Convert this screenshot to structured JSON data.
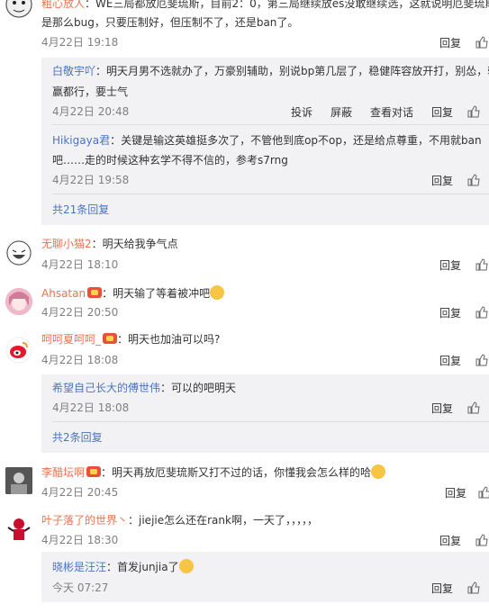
{
  "comments": [
    {
      "user": "粗心放人",
      "text_line1": "：WE三局都放厄斐琉斯，目前2：0，第三局继续放es没敢继续选，这就说明厄斐琉斯",
      "text_line2": "是那么bug，只要压制好，但压制不了，还是ban了。",
      "time": "4月22日 19:18",
      "reply": "回复",
      "replies": [
        {
          "user": "白敬宇吖",
          "text_line1": "：明天月男不选就办了，万豪别辅助，别说bp第几层了，稳健阵容放开打，别怂，输",
          "text_line2": "赢都行，要士气",
          "time": "4月22日 20:48",
          "report": "投诉",
          "block": "屏蔽",
          "view": "查看对话",
          "reply": "回复"
        },
        {
          "user": "Hikigaya君",
          "text_line1": "：关键是输这英雄挺多次了，不管他到底op不op，还是给点尊重，不用就ban",
          "text_line2": "吧……走的时候这种玄学不得不信的，参考s7rng",
          "time": "4月22日 19:58",
          "reply": "回复"
        }
      ],
      "more": "共21条回复"
    },
    {
      "user": "无聊小猫2",
      "text_line1": "：明天给我争气点",
      "time": "4月22日 18:10",
      "reply": "回复"
    },
    {
      "user": "Ahsatan",
      "text_line1": "：明天输了等着被冲吧",
      "time": "4月22日 20:50",
      "reply": "回复"
    },
    {
      "user": "呵呵夏呵呵_",
      "text_line1": "：明天也加油可以吗?",
      "time": "4月22日 18:08",
      "reply": "回复",
      "replies": [
        {
          "user": "希望自己长大的傅世伟",
          "text_line1": "：可以的吧明天",
          "time": "4月22日 18:08",
          "reply": "回复"
        }
      ],
      "more": "共2条回复"
    },
    {
      "user": "李醋坛啊",
      "text_line1": "：明天再放厄斐琉斯又打不过的话，你懂我会怎么样的哈",
      "time": "4月22日 20:45",
      "reply": "回复"
    },
    {
      "user": "叶子落了的世界丶",
      "text_line1": "：jiejie怎么还在rank啊，一天了，，，，，",
      "time": "4月22日 18:30",
      "reply": "回复",
      "replies": [
        {
          "user": "晓彬是汪汪",
          "text_line1": "：首发junjia了",
          "time": "今天 07:27",
          "reply": "回复"
        }
      ]
    }
  ],
  "colors": {
    "username": "#eb7350",
    "reply_username": "#4a74c4",
    "reply_bg": "#f2f2f5",
    "meta": "#808080"
  }
}
